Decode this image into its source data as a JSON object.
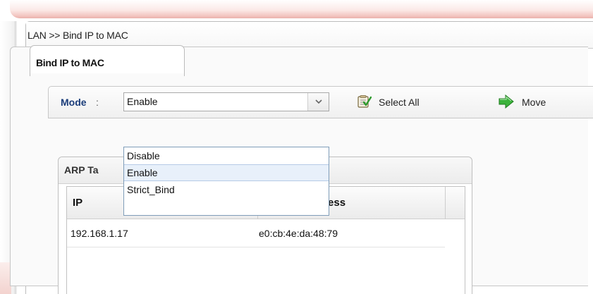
{
  "breadcrumb": "LAN >> Bind IP to MAC",
  "tab": {
    "label": "Bind IP to MAC"
  },
  "toolbar": {
    "mode_label": "Mode",
    "mode_colon": ":",
    "mode_value": "Enable",
    "select_all_label": "Select All",
    "move_label": "Move"
  },
  "mode_options": [
    "Disable",
    "Enable",
    "Strict_Bind"
  ],
  "mode_selected": "Enable",
  "arp_table": {
    "title": "ARP Ta",
    "columns": {
      "ip": "IP",
      "mac": "lress"
    },
    "rows": [
      {
        "ip": "192.168.1.17",
        "mac": "e0:cb:4e:da:48:79"
      }
    ]
  },
  "colors": {
    "mode_label": "#1b3d7a",
    "dropdown_highlight": "#e8f0fa",
    "border": "#bdbdbd"
  },
  "icons": {
    "select_all": "clipboard-check-icon",
    "move": "green-arrow-icon",
    "dropdown": "chevron-down-icon"
  }
}
